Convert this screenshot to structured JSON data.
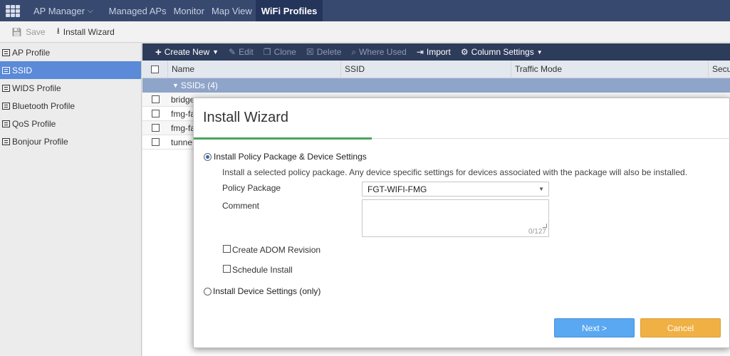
{
  "topnav": {
    "app": "AP Manager",
    "items": [
      {
        "label": "Managed APs"
      },
      {
        "label": "Monitor"
      },
      {
        "label": "Map View"
      },
      {
        "label": "WiFi Profiles"
      }
    ],
    "active": "WiFi Profiles"
  },
  "toolbar": {
    "save_label": "Save",
    "install_label": "Install Wizard"
  },
  "sidebar": {
    "items": [
      {
        "label": "AP Profile"
      },
      {
        "label": "SSID"
      },
      {
        "label": "WIDS Profile"
      },
      {
        "label": "Bluetooth Profile"
      },
      {
        "label": "QoS Profile"
      },
      {
        "label": "Bonjour Profile"
      }
    ],
    "active": "SSID"
  },
  "content_toolbar": {
    "create": "Create New",
    "edit": "Edit",
    "clone": "Clone",
    "delete": "Delete",
    "where_used": "Where Used",
    "import": "Import",
    "column_settings": "Column Settings"
  },
  "table": {
    "columns": [
      "Name",
      "SSID",
      "Traffic Mode",
      "Secu"
    ],
    "group_label": "SSIDs (4)",
    "rows": [
      {
        "name": "bridge"
      },
      {
        "name": "fmg-fa"
      },
      {
        "name": "fmg-fa"
      },
      {
        "name": "tunne"
      }
    ]
  },
  "modal": {
    "title": "Install Wizard",
    "option1": "Install Policy Package & Device Settings",
    "option1_desc": "Install a selected policy package. Any device specific settings for devices associated with the package will also be installed.",
    "policy_package_label": "Policy Package",
    "policy_package_value": "FGT-WIFI-FMG",
    "comment_label": "Comment",
    "comment_counter": "0/127",
    "create_adom_revision": "Create ADOM Revision",
    "schedule_install": "Schedule Install",
    "option2": "Install Device Settings (only)",
    "next_label": "Next >",
    "cancel_label": "Cancel"
  },
  "colors": {
    "nav_bg": "#38496f",
    "active_nav": "#25345a",
    "sidebar_active": "#5a8ad8",
    "next_button": "#5aa7f2",
    "cancel_button": "#f0b044",
    "progress": "#4ca55a"
  }
}
